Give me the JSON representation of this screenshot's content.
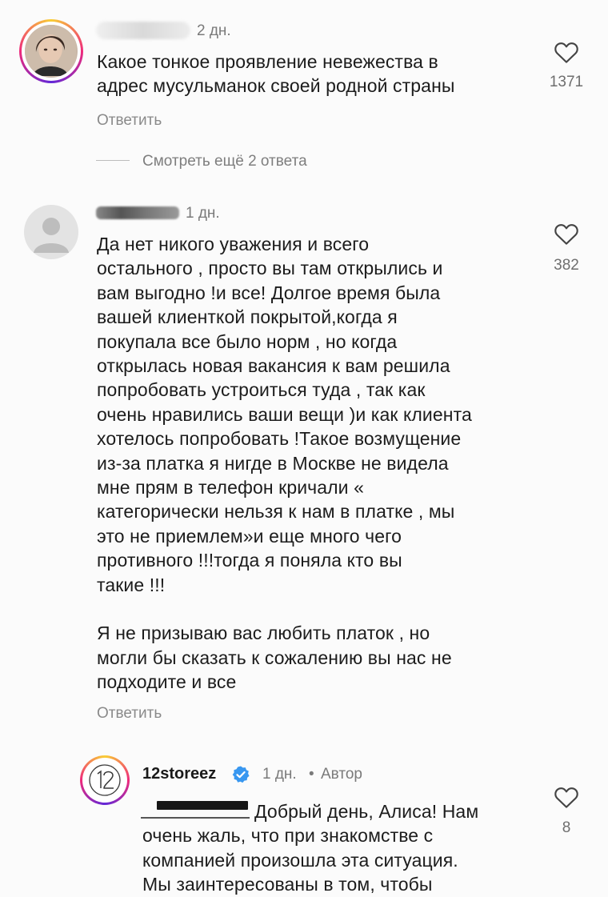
{
  "comments": [
    {
      "time": "2 дн.",
      "text_lines": [
        "Какое тонкое проявление невежества в",
        "адрес мусульманок своей родной страны"
      ],
      "likes": "1371",
      "reply_label": "Ответить",
      "view_replies": "Смотреть ещё 2 ответа"
    },
    {
      "time": "1 дн.",
      "text_lines": [
        "Да нет никого уважения и всего",
        "остального , просто вы там открылись и",
        "вам выгодно !и все! Долгое время была",
        "вашей клиенткой покрытой,когда я",
        "покупала все было норм , но когда",
        "открылась новая вакансия к вам решила",
        "попробовать устроиться туда , так как",
        "очень нравились ваши вещи )и как клиента",
        "хотелось попробовать !Такое возмущение",
        "из-за платка я нигде в Москве не видела",
        "мне прям в телефон кричали «",
        "категорически нельзя к нам в платке , мы",
        "это не приемлем»и еще много чего",
        "противного !!!тогда я поняла кто вы",
        "такие !!!",
        "",
        "Я не призываю вас любить платок , но",
        "могли бы сказать к сожалению вы нас не",
        "подходите и все"
      ],
      "likes": "382",
      "reply_label": "Ответить"
    },
    {
      "username": "12storeez",
      "time": "1 дн.",
      "separator": "•",
      "author_badge": "Автор",
      "text_lines": [
        "Добрый день, Алиса! Нам",
        "очень жаль, что при знакомстве с",
        "компанией произошла эта ситуация.",
        "Мы заинтересованы в том, чтобы"
      ],
      "likes": "8"
    }
  ],
  "colors": {
    "verified": "#3897f0",
    "muted_text": "#7a7a7a",
    "body_text": "#1c1c1c"
  },
  "icons": [
    "heart-icon",
    "verified-badge-icon",
    "default-avatar-icon"
  ]
}
